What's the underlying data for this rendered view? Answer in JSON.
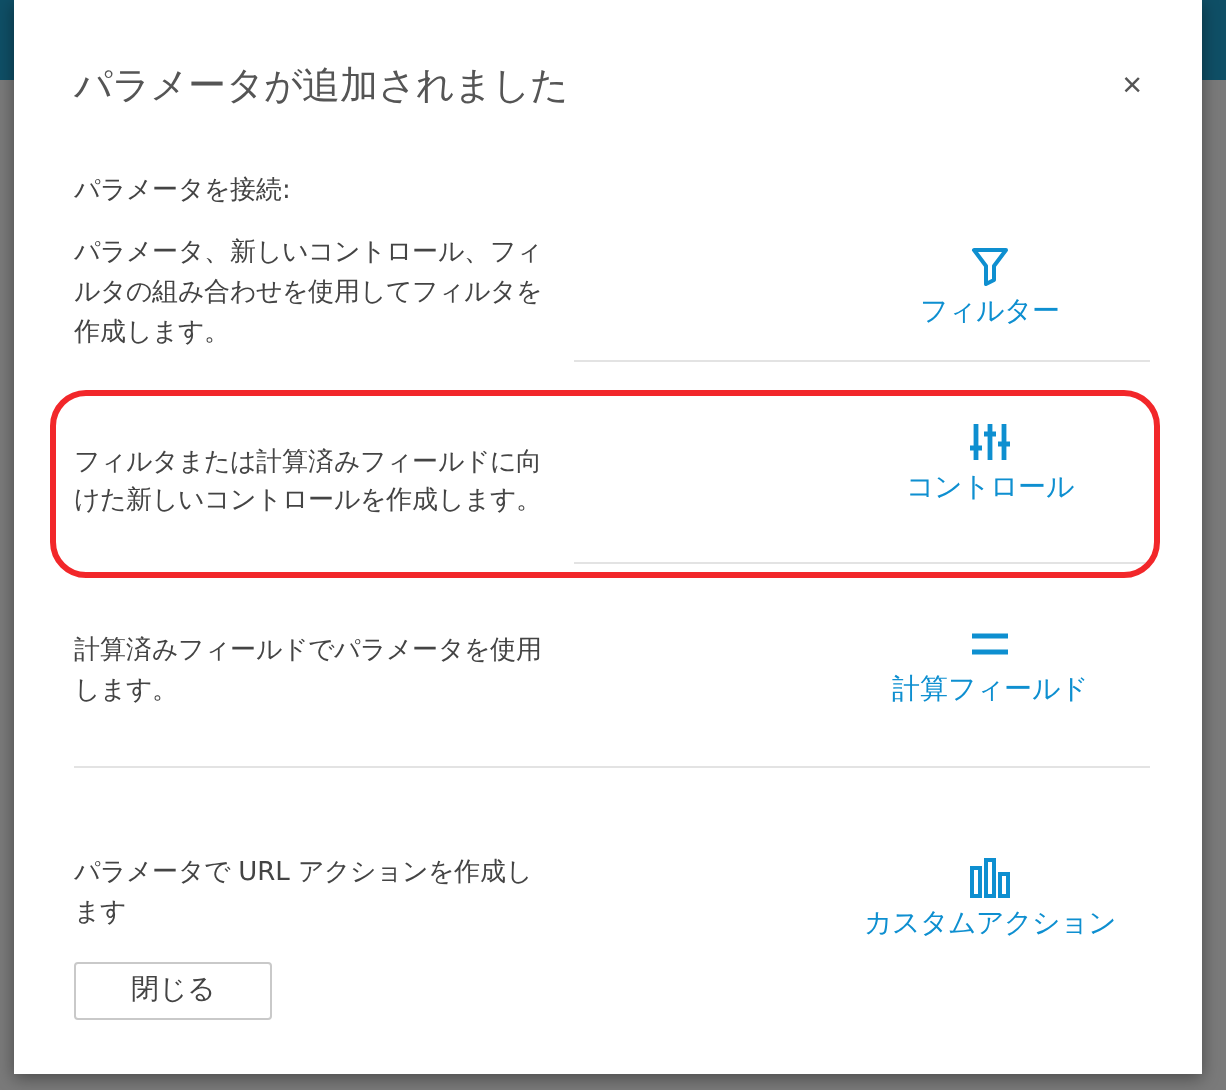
{
  "dialog": {
    "title": "パラメータが追加されました",
    "close": "×",
    "subtitle": "パラメータを接続:",
    "options": [
      {
        "kind": "filter",
        "description": "パラメータ、新しいコントロール、フィルタの組み合わせを使用してフィルタを作成します。",
        "label": "フィルター",
        "highlighted": false
      },
      {
        "kind": "control",
        "description": "フィルタまたは計算済みフィールドに向けた新しいコントロールを作成します。",
        "label": "コントロール",
        "highlighted": true
      },
      {
        "kind": "calculated",
        "description": "計算済みフィールドでパラメータを使用します。",
        "label": "計算フィールド",
        "highlighted": false
      },
      {
        "kind": "action",
        "description": "パラメータで URL アクションを作成します",
        "label": "カスタムアクション",
        "highlighted": false
      }
    ],
    "buttons": [
      "閉じる"
    ]
  }
}
